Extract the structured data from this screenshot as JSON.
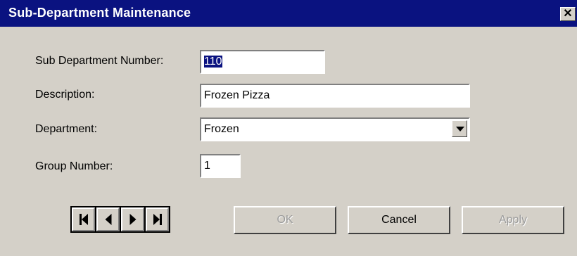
{
  "window": {
    "title": "Sub-Department Maintenance",
    "close_glyph": "✕",
    "title_bg": "#0a1280"
  },
  "form": {
    "sub_dept_number": {
      "label": "Sub Department Number:",
      "value": "110"
    },
    "description": {
      "label": "Description:",
      "value": "Frozen Pizza"
    },
    "department": {
      "label": "Department:",
      "value": "Frozen"
    },
    "group_number": {
      "label": "Group Number:",
      "value": "1"
    }
  },
  "navigation": {
    "first_icon": "first-record-icon",
    "prev_icon": "previous-record-icon",
    "next_icon": "next-record-icon",
    "last_icon": "last-record-icon"
  },
  "buttons": {
    "ok": "OK",
    "cancel": "Cancel",
    "apply": "Apply"
  }
}
